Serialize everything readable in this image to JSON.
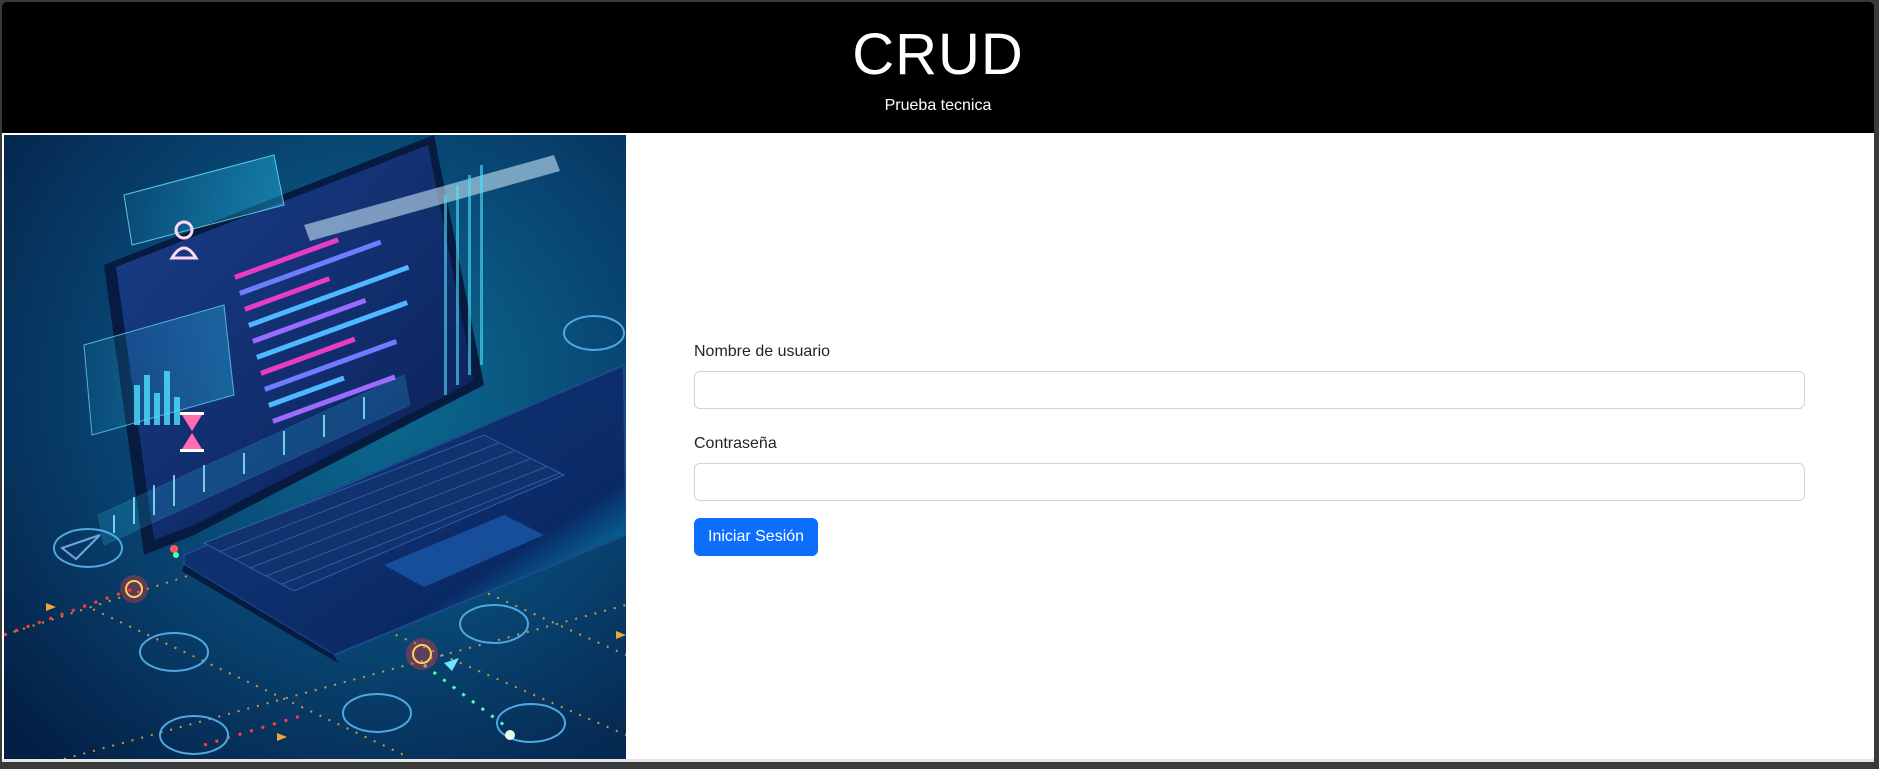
{
  "header": {
    "title": "CRUD",
    "subtitle": "Prueba tecnica"
  },
  "hero": {
    "image": "laptop-code-illustration",
    "colors": {
      "bg_dark": "#06264f",
      "bg_light": "#0a5c86",
      "accent_cyan": "#00e6f0",
      "accent_magenta": "#e83cc8",
      "accent_orange": "#f2a63a",
      "accent_red": "#ff3b3b"
    }
  },
  "login_form": {
    "username_label": "Nombre de usuario",
    "username_value": "",
    "password_label": "Contraseña",
    "password_value": "",
    "submit_label": "Iniciar Sesión"
  },
  "colors": {
    "header_bg": "#000000",
    "primary": "#0d6efd"
  }
}
